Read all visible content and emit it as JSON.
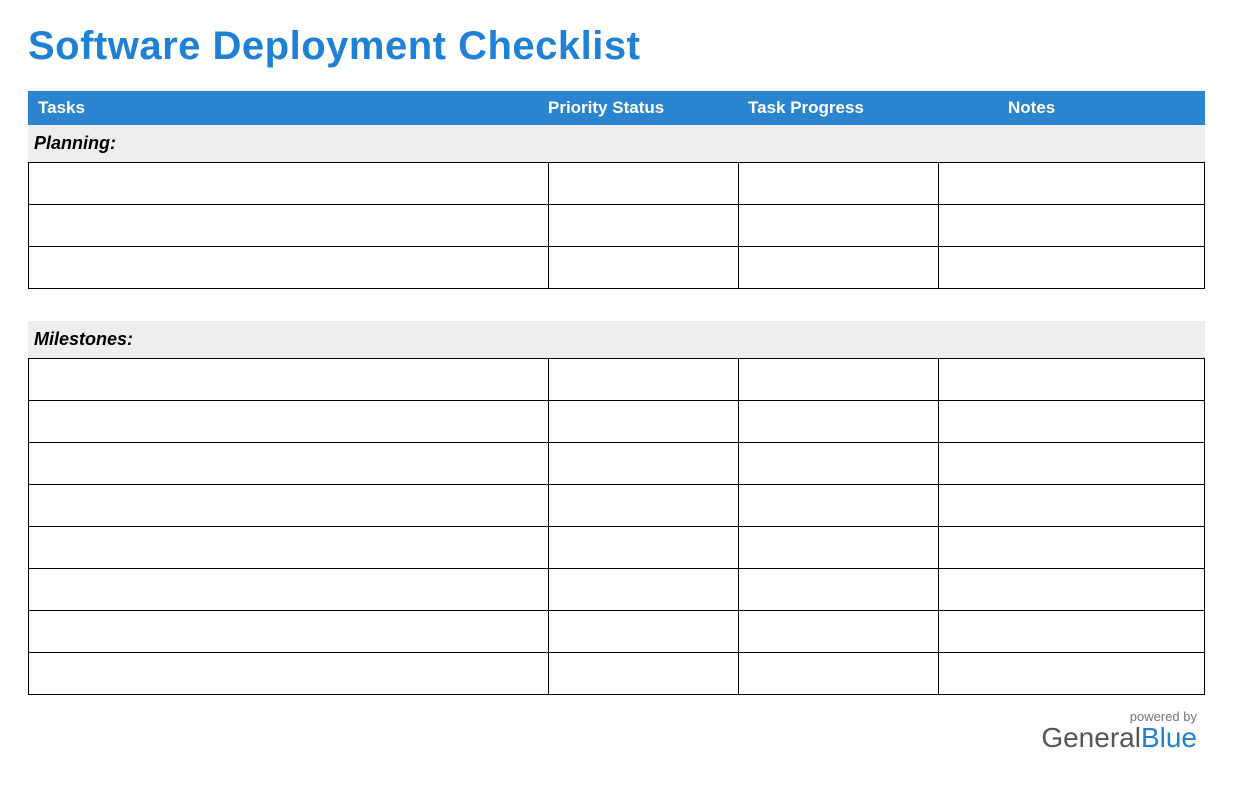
{
  "title": "Software Deployment Checklist",
  "columns": {
    "tasks": "Tasks",
    "priority": "Priority Status",
    "progress": "Task Progress",
    "notes": "Notes"
  },
  "sections": [
    {
      "label": "Planning:",
      "rows": [
        {
          "task": "",
          "priority": "",
          "progress": "",
          "notes": ""
        },
        {
          "task": "",
          "priority": "",
          "progress": "",
          "notes": ""
        },
        {
          "task": "",
          "priority": "",
          "progress": "",
          "notes": ""
        }
      ]
    },
    {
      "label": "Milestones:",
      "rows": [
        {
          "task": "",
          "priority": "",
          "progress": "",
          "notes": ""
        },
        {
          "task": "",
          "priority": "",
          "progress": "",
          "notes": ""
        },
        {
          "task": "",
          "priority": "",
          "progress": "",
          "notes": ""
        },
        {
          "task": "",
          "priority": "",
          "progress": "",
          "notes": ""
        },
        {
          "task": "",
          "priority": "",
          "progress": "",
          "notes": ""
        },
        {
          "task": "",
          "priority": "",
          "progress": "",
          "notes": ""
        },
        {
          "task": "",
          "priority": "",
          "progress": "",
          "notes": ""
        },
        {
          "task": "",
          "priority": "",
          "progress": "",
          "notes": ""
        }
      ]
    }
  ],
  "footer": {
    "powered": "powered by",
    "logo_general": "General",
    "logo_blue": "Blue"
  }
}
